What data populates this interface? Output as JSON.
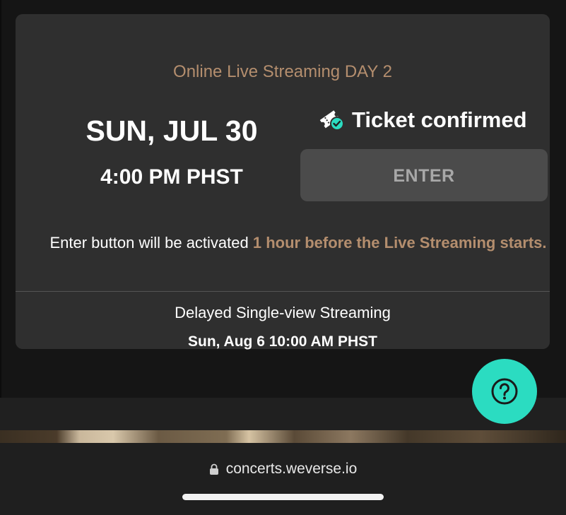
{
  "event": {
    "title": "Online Live Streaming DAY 2",
    "date": "SUN, JUL 30",
    "time": "4:00 PM PHST"
  },
  "ticket": {
    "status": "Ticket confirmed",
    "icon": "ticket-check-icon"
  },
  "enter_button": {
    "label": "ENTER",
    "state": "disabled"
  },
  "notice": {
    "prefix": "Enter button will be activated ",
    "highlight": "1 hour before the Live Streaming starts."
  },
  "delayed": {
    "title": "Delayed Single-view Streaming",
    "date": "Sun, Aug 6 10:00 AM PHST"
  },
  "help": {
    "icon": "question-icon"
  },
  "browser": {
    "url": "concerts.weverse.io",
    "icon": "lock-icon"
  },
  "colors": {
    "accent": "#b48e6e",
    "help_button": "#2bdcc1",
    "card_background": "#2f2f2f",
    "page_background": "#151515",
    "enter_button_background": "#4b4b4b"
  }
}
